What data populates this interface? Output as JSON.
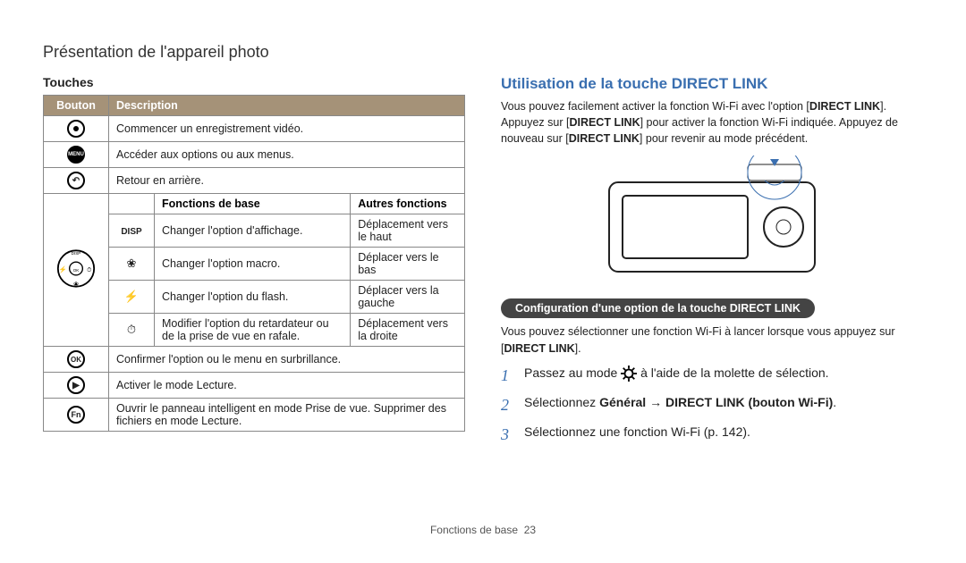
{
  "breadcrumb": "Présentation de l'appareil photo",
  "left": {
    "heading": "Touches",
    "th_button": "Bouton",
    "th_desc": "Description",
    "th_base": "Fonctions de base",
    "th_other": "Autres fonctions",
    "rows_top": [
      {
        "desc": "Commencer un enregistrement vidéo."
      },
      {
        "desc": "Accéder aux options ou aux menus."
      },
      {
        "desc": "Retour en arrière."
      }
    ],
    "pad_rows": [
      {
        "icon": "DISP",
        "base": "Changer l'option d'affichage.",
        "other": "Déplacement vers le haut"
      },
      {
        "icon": "macro",
        "base": "Changer l'option macro.",
        "other": "Déplacer vers le bas"
      },
      {
        "icon": "flash",
        "base": "Changer l'option du flash.",
        "other": "Déplacer vers la gauche"
      },
      {
        "icon": "timer",
        "base": "Modifier l'option du retardateur ou de la prise de vue en rafale.",
        "other": "Déplacement vers la droite"
      }
    ],
    "rows_bottom": [
      {
        "label": "OK",
        "desc": "Confirmer l'option ou le menu en surbrillance."
      },
      {
        "label": "play",
        "desc": "Activer le mode Lecture."
      },
      {
        "label": "Fn",
        "desc": "Ouvrir le panneau intelligent en mode Prise de vue. Supprimer des fichiers en mode Lecture."
      }
    ]
  },
  "right": {
    "title": "Utilisation de la touche DIRECT LINK",
    "intro_1": "Vous pouvez facilement activer la fonction Wi-Fi avec l'option [",
    "intro_dl": "DIRECT LINK",
    "intro_2": "]. Appuyez sur [",
    "intro_3": "] pour activer la fonction Wi-Fi indiquée. Appuyez de nouveau sur [",
    "intro_4": "] pour revenir au mode précédent.",
    "pill": "Configuration d'une option de la touche DIRECT LINK",
    "p2_a": "Vous pouvez sélectionner une fonction Wi-Fi à lancer lorsque vous appuyez sur [",
    "p2_b": "].",
    "steps": [
      {
        "n": "1",
        "pre": "Passez au mode ",
        "post": " à l'aide de la molette de sélection."
      },
      {
        "n": "2",
        "pre": "Sélectionnez ",
        "bold": "Général → DIRECT LINK (bouton Wi-Fi)",
        "post": "."
      },
      {
        "n": "3",
        "pre": "Sélectionnez une fonction Wi-Fi (p. 142).",
        "bold": "",
        "post": ""
      }
    ]
  },
  "footer": {
    "label": "Fonctions de base",
    "page": "23"
  }
}
